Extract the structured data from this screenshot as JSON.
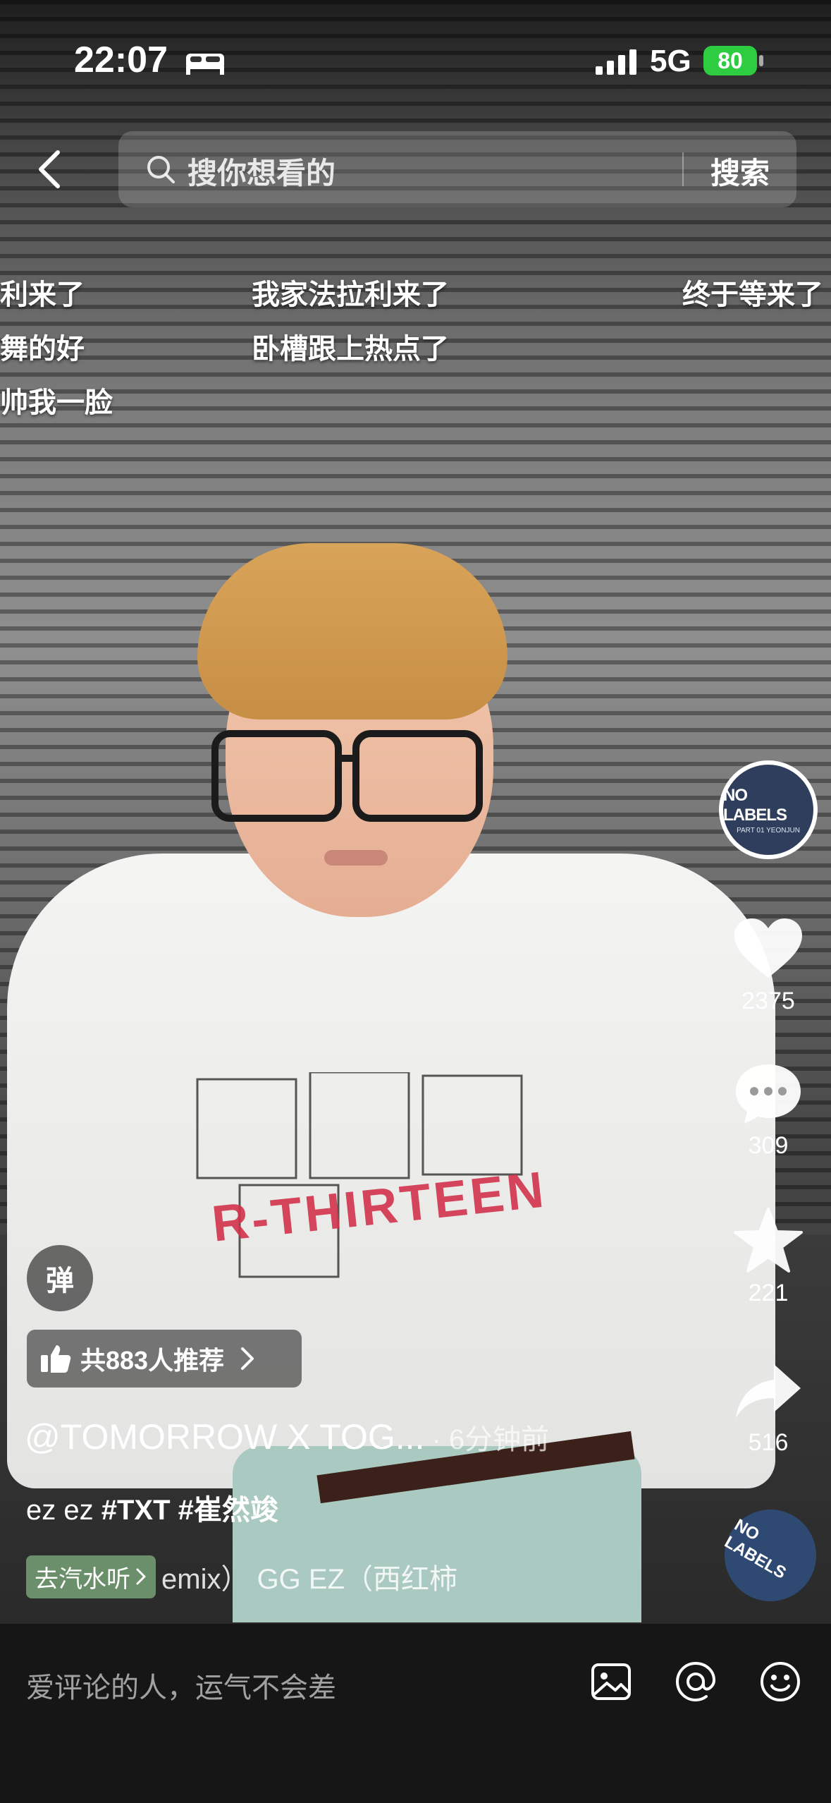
{
  "status_bar": {
    "time": "22:07",
    "network": "5G",
    "battery": "80",
    "icons": [
      "sleep-mode-icon",
      "signal-icon",
      "battery-icon"
    ]
  },
  "header": {
    "search_placeholder": "搜你想看的",
    "search_button": "搜索"
  },
  "danmaku": [
    "利来了",
    "我家法拉利来了",
    "终于等来了",
    "舞的好",
    "卧槽跟上热点了",
    "帅我一脸"
  ],
  "music_disc": {
    "title": "NO LABELS",
    "subtitle": "PART 01   YEONJUN"
  },
  "actions": {
    "like_count": "2375",
    "comment_count": "309",
    "favorite_count": "221",
    "share_count": "516"
  },
  "overlay": {
    "danmu_toggle": "弹",
    "recommend": "共883人推荐",
    "author": "@TOMORROW X TOG...",
    "time_ago": "· 6分钟前",
    "caption_plain": "ez ez ",
    "caption_tags": "#TXT #崔然竣",
    "music_tag": "去汽水听",
    "music_text": "emix）     GG EZ（西红柿"
  },
  "comment_bar": {
    "placeholder": "爱评论的人，运气不会差"
  },
  "colors": {
    "battery_green": "#2ecc40",
    "comment_bar_bg": "#161616",
    "disc_blue": "#2f3e5c"
  }
}
